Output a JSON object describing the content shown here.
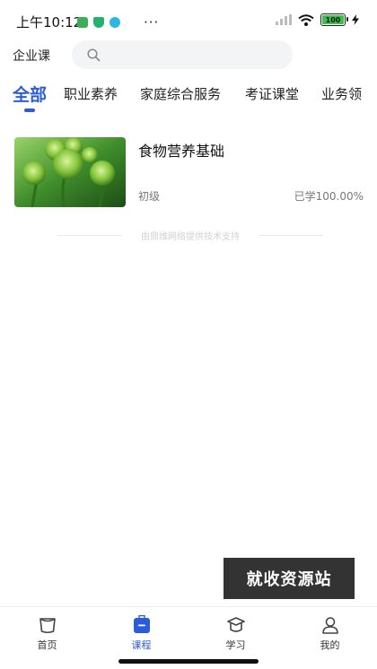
{
  "status_bar": {
    "time": "上午10:12",
    "more": "···",
    "battery": "100"
  },
  "header": {
    "title": "企业课",
    "search_placeholder": ""
  },
  "tabs": [
    {
      "label": "全部",
      "active": true
    },
    {
      "label": "职业素养",
      "active": false
    },
    {
      "label": "家庭综合服务",
      "active": false
    },
    {
      "label": "考证课堂",
      "active": false
    },
    {
      "label": "业务领",
      "active": false
    }
  ],
  "courses": [
    {
      "title": "食物营养基础",
      "level": "初级",
      "progress_label": "已学100.00%",
      "progress": 1.0
    }
  ],
  "credit": "由鼎维网络提供技术支持",
  "watermark": "就收资源站",
  "bottom_nav": [
    {
      "label": "首页",
      "icon": "home-icon",
      "active": false
    },
    {
      "label": "课程",
      "icon": "course-icon",
      "active": true
    },
    {
      "label": "学习",
      "icon": "study-icon",
      "active": false
    },
    {
      "label": "我的",
      "icon": "profile-icon",
      "active": false
    }
  ],
  "colors": {
    "accent": "#2d5cdb",
    "battery_green": "#38c24b"
  }
}
